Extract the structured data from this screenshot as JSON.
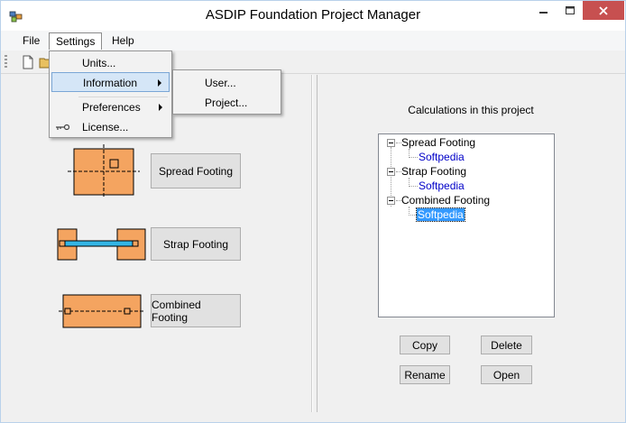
{
  "window": {
    "title": "ASDIP Foundation Project Manager",
    "close_color": "#c75050"
  },
  "menubar": {
    "items": [
      "File",
      "Settings",
      "Help"
    ]
  },
  "settings_menu": {
    "units": "Units...",
    "information": "Information",
    "preferences": "Preferences",
    "license": "License..."
  },
  "information_submenu": {
    "user": "User...",
    "project": "Project..."
  },
  "footings": {
    "spread": "Spread Footing",
    "strap": "Strap Footing",
    "combined": "Combined Footing",
    "fill_color": "#f4a460",
    "strap_color": "#33b5e5"
  },
  "calculations": {
    "title": "Calculations in this project",
    "tree": [
      {
        "label": "Spread Footing",
        "children": [
          "Softpedia"
        ]
      },
      {
        "label": "Strap Footing",
        "children": [
          "Softpedia"
        ]
      },
      {
        "label": "Combined Footing",
        "children": [
          "Softpedia"
        ],
        "selected_child": true
      }
    ]
  },
  "actions": {
    "copy": "Copy",
    "delete": "Delete",
    "rename": "Rename",
    "open": "Open"
  }
}
